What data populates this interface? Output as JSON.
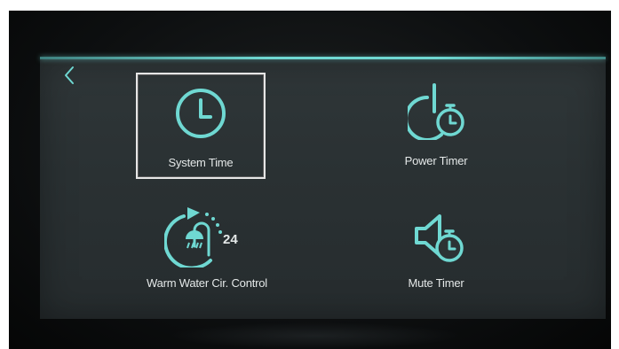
{
  "colors": {
    "accent": "#6fd8d2",
    "screen_bg": "#2c3335",
    "label_text": "#e4e8e8",
    "selection_border": "#e6e6e6"
  },
  "nav": {
    "back_icon": "chevron-left-icon"
  },
  "menu": {
    "system_time": {
      "label": "System Time",
      "icon": "clock-icon",
      "selected": true
    },
    "power_timer": {
      "label": "Power Timer",
      "icon": "power-timer-icon",
      "selected": false
    },
    "warm_water": {
      "label": "Warm Water Cir. Control",
      "icon": "shower-circulation-icon",
      "badge": "24",
      "selected": false
    },
    "mute_timer": {
      "label": "Mute Timer",
      "icon": "mute-timer-icon",
      "selected": false
    }
  }
}
